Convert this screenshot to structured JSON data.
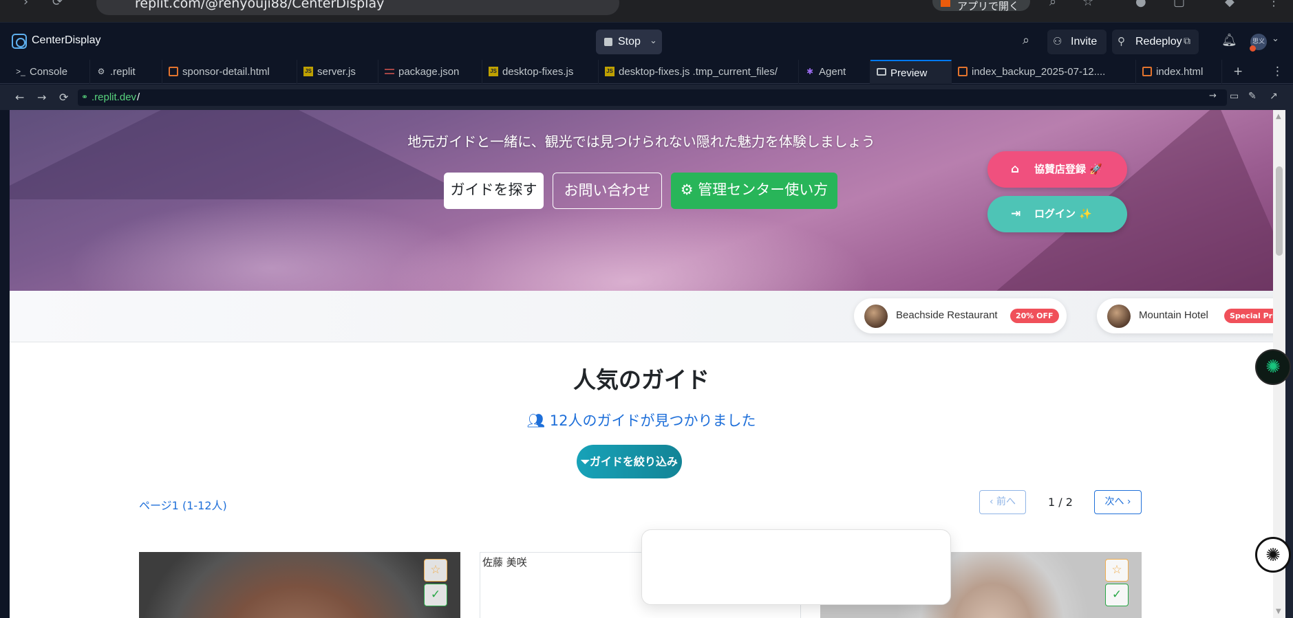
{
  "browser": {
    "url": "replit.com/@renyouji88/CenterDisplay",
    "open_app_label": "アプリで開く"
  },
  "header": {
    "project_name": "CenterDisplay",
    "stop_label": "Stop",
    "invite_label": "Invite",
    "redeploy_label": "Redeploy",
    "avatar_text": "思义"
  },
  "tabs": [
    {
      "label": "Console",
      "icon": "terminal-icon"
    },
    {
      "label": ".replit",
      "icon": "config-icon"
    },
    {
      "label": "sponsor-detail.html",
      "icon": "html-file-icon"
    },
    {
      "label": "server.js",
      "icon": "js-file-icon"
    },
    {
      "label": "package.json",
      "icon": "json-file-icon"
    },
    {
      "label": "desktop-fixes.js",
      "icon": "js-file-icon"
    },
    {
      "label": "desktop-fixes.js .tmp_current_files/",
      "icon": "js-file-icon"
    },
    {
      "label": "Agent",
      "icon": "agent-icon"
    },
    {
      "label": "Preview",
      "icon": "preview-icon",
      "active": true
    },
    {
      "label": "index_backup_2025-07-12....",
      "icon": "html-file-icon"
    },
    {
      "label": "index.html",
      "icon": "html-file-icon"
    }
  ],
  "address": {
    "host": ".replit.dev",
    "path": "/"
  },
  "hero": {
    "subtitle": "地元ガイドと一緒に、観光では見つけられない隠れた魅力を体験しましょう",
    "find_guide": "ガイドを探す",
    "contact": "お問い合わせ",
    "admin_help": "管理センター使い方",
    "sponsor_register": "協賛店登録 🚀",
    "login": "ログイン ✨"
  },
  "sponsors": [
    {
      "name": "Beachside Restaurant",
      "badge": "20% OFF"
    },
    {
      "name": "Mountain Hotel",
      "badge": "Special Price"
    }
  ],
  "section": {
    "title": "人気のガイド",
    "found": "12人のガイドが見つかりました",
    "filter": "ガイドを絞り込み",
    "page_label": "ページ1 (1-12人)",
    "prev": "前へ",
    "next": "次へ",
    "page_count": "1 / 2"
  },
  "cards": [
    {
      "alt": ""
    },
    {
      "alt": "佐藤 美咲"
    },
    {
      "alt": ""
    }
  ],
  "colors": {
    "accent": "#0079f2",
    "admin_green": "#28b559",
    "sponsor_pink": "#f0507e",
    "login_teal": "#4ec4b6",
    "filter_teal": "#17a2b8"
  }
}
